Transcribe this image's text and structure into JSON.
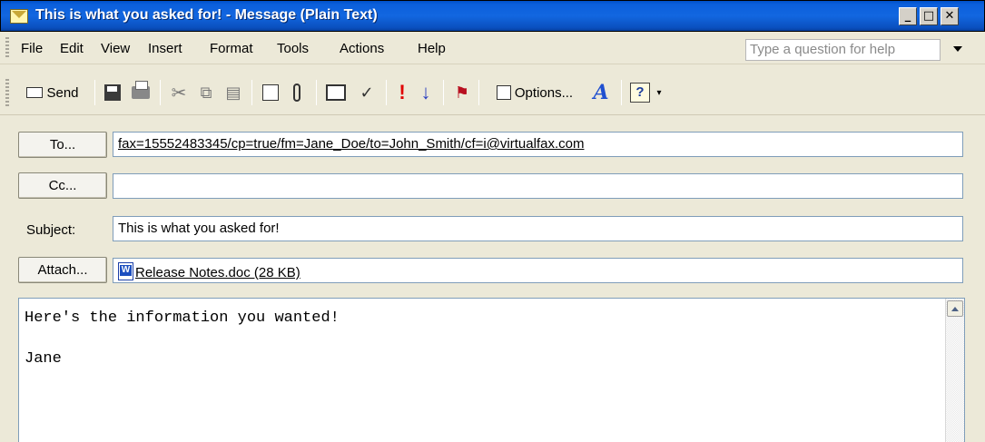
{
  "window": {
    "title": "This is what you asked for! - Message (Plain Text)",
    "controls": {
      "minimize": "_",
      "maximize": "□",
      "close": "✕"
    }
  },
  "menu": {
    "items": [
      "File",
      "Edit",
      "View",
      "Insert",
      "Format",
      "Tools",
      "Actions",
      "Help"
    ],
    "help_placeholder": "Type a question for help"
  },
  "toolbar": {
    "send_label": "Send",
    "options_label": "Options...",
    "icons": [
      "send-icon",
      "save-icon",
      "print-icon",
      "cut-icon",
      "copy-icon",
      "paste-icon",
      "insert-form-icon",
      "attach-icon",
      "address-book-icon",
      "check-names-icon",
      "high-importance-icon",
      "low-importance-icon",
      "flag-icon",
      "options-icon",
      "font-icon",
      "help-icon"
    ]
  },
  "fields": {
    "to_label": "To...",
    "to_value": "fax=15552483345/cp=true/fm=Jane_Doe/to=John_Smith/cf=i@virtualfax.com",
    "cc_label": "Cc...",
    "cc_value": "",
    "subject_label": "Subject:",
    "subject_value": "This is what you asked for!",
    "attach_label": "Attach...",
    "attachment": "Release Notes.doc (28 KB)"
  },
  "body": {
    "line1": "Here's the information you wanted!",
    "line2": "",
    "line3": "Jane"
  },
  "colors": {
    "titlebar": "#0B5FDC",
    "chrome": "#ECE9D8",
    "input_border": "#7F9DB9",
    "high_importance": "#E00000",
    "low_importance": "#2A3FC0"
  }
}
